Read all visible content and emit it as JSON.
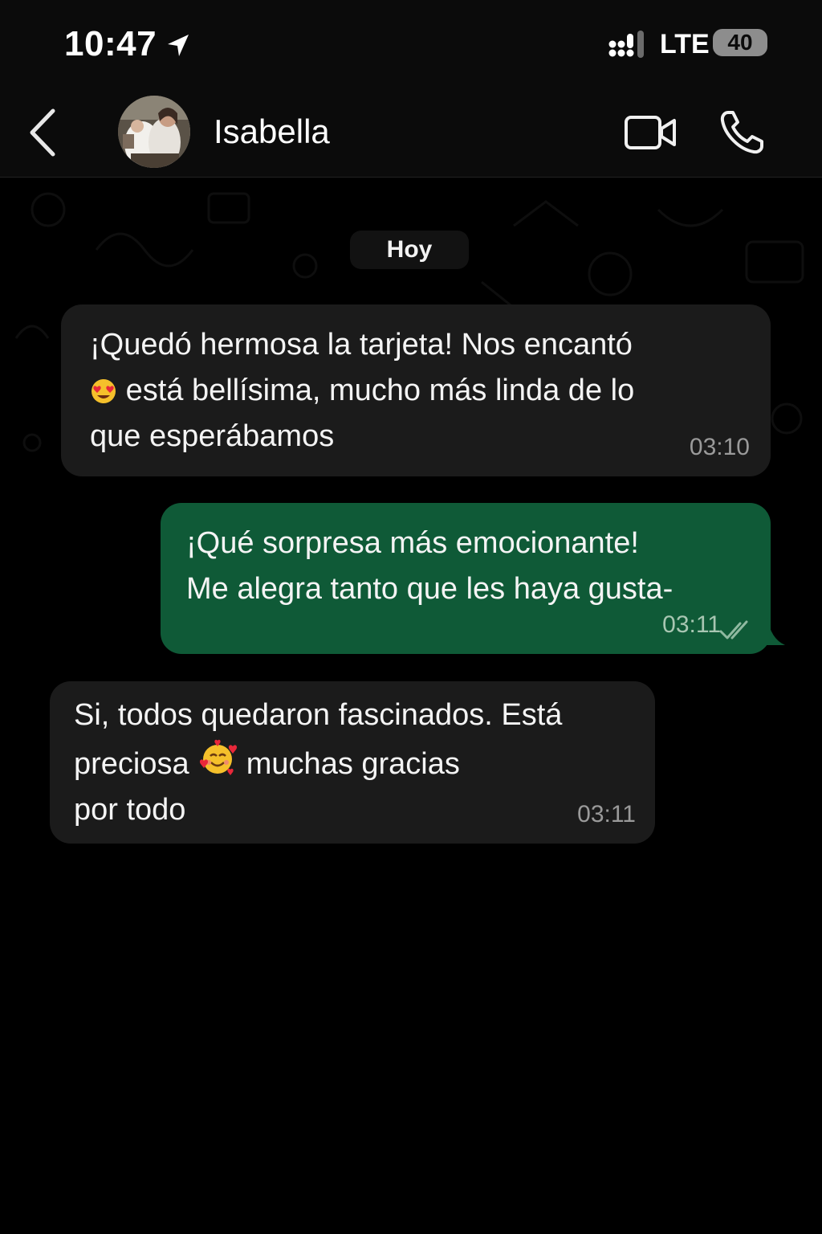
{
  "status_bar": {
    "time": "10:47",
    "network": "LTE",
    "battery": "40"
  },
  "header": {
    "contact_name": "Isabella",
    "back_icon": "chevron-left-icon",
    "video_icon": "video-camera-icon",
    "call_icon": "phone-icon"
  },
  "chat": {
    "date_label": "Hoy",
    "messages": [
      {
        "direction": "incoming",
        "lines": [
          "¡Quedó hermosa la tarjeta! Nos encantó",
          "está bellísima, mucho más linda de lo",
          "que esperábamos"
        ],
        "emoji": "heart-eyes",
        "time": "03:10"
      },
      {
        "direction": "outgoing",
        "lines": [
          "¡Qué sorpresa más emocionante!",
          "Me alegra tanto que les haya gusta-"
        ],
        "time": "03:11",
        "status": "read"
      },
      {
        "direction": "incoming",
        "lines": [
          "Si, todos quedaron fascinados. Está",
          "preciosa",
          "muchas gracias",
          "por todo"
        ],
        "emoji": "smiling-face-with-hearts",
        "time": "03:11"
      }
    ]
  },
  "colors": {
    "background": "#000000",
    "incoming_bubble": "#1b1b1b",
    "outgoing_bubble": "#0f5a37",
    "accent": "#0f5a37"
  }
}
